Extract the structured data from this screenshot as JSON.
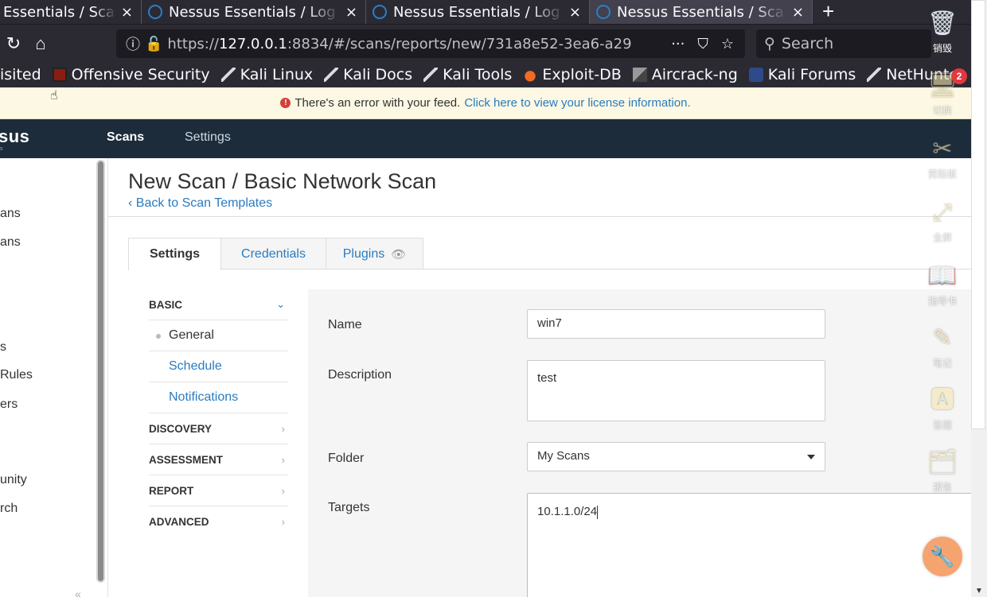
{
  "browser": {
    "tabs": [
      {
        "title": "Essentials / Sca",
        "active": false
      },
      {
        "title": "Nessus Essentials / Log",
        "active": false
      },
      {
        "title": "Nessus Essentials / Log",
        "active": false
      },
      {
        "title": "Nessus Essentials / Sca",
        "active": true
      }
    ],
    "tab_close": "×",
    "new_tab": "+",
    "url_prefix": "https://",
    "url_host": "127.0.0.1",
    "url_rest": ":8834/#/scans/reports/new/731a8e52-3ea6-a29",
    "search_placeholder": "Search",
    "bookmarks": [
      {
        "label": "isited",
        "icon": "none"
      },
      {
        "label": "Offensive Security",
        "icon": "offsec"
      },
      {
        "label": "Kali Linux",
        "icon": "dragon"
      },
      {
        "label": "Kali Docs",
        "icon": "dragon"
      },
      {
        "label": "Kali Tools",
        "icon": "dragon"
      },
      {
        "label": "Exploit-DB",
        "icon": "exploit"
      },
      {
        "label": "Aircrack-ng",
        "icon": "air"
      },
      {
        "label": "Kali Forums",
        "icon": "forum"
      },
      {
        "label": "NetHunter",
        "icon": "dragon"
      }
    ]
  },
  "banner": {
    "text": "There's an error with your feed.",
    "link": "Click here to view your license information."
  },
  "app": {
    "logo": "sus",
    "logo_sub": "s",
    "nav": {
      "scans": "Scans",
      "settings": "Settings"
    }
  },
  "sidebar": {
    "items": [
      "ans",
      "ans",
      "s",
      "Rules",
      "ers",
      "unity",
      "rch"
    ],
    "collapse": "«"
  },
  "page": {
    "title": "New Scan / Basic Network Scan",
    "back": "‹ Back to Scan Templates",
    "tabs": {
      "settings": "Settings",
      "credentials": "Credentials",
      "plugins": "Plugins"
    }
  },
  "menu": {
    "basic": "BASIC",
    "general": "General",
    "schedule": "Schedule",
    "notifications": "Notifications",
    "discovery": "DISCOVERY",
    "assessment": "ASSESSMENT",
    "report": "REPORT",
    "advanced": "ADVANCED"
  },
  "form": {
    "name_label": "Name",
    "name_value": "win7",
    "desc_label": "Description",
    "desc_value": "test",
    "folder_label": "Folder",
    "folder_value": "My Scans",
    "targets_label": "Targets",
    "targets_value": "10.1.1.0/24"
  },
  "tools": {
    "destroy": "销毁",
    "badge": "2",
    "switch": "切换",
    "scissors": "剪贴板",
    "fullscreen": "全屏",
    "reader": "指导书",
    "notes": "笔记",
    "answer": "答题",
    "report": "报告"
  },
  "colors": {
    "accent": "#2a7bc0",
    "header": "#1c2c3b",
    "banner": "#fcf8e3",
    "error": "#d43f3a"
  }
}
